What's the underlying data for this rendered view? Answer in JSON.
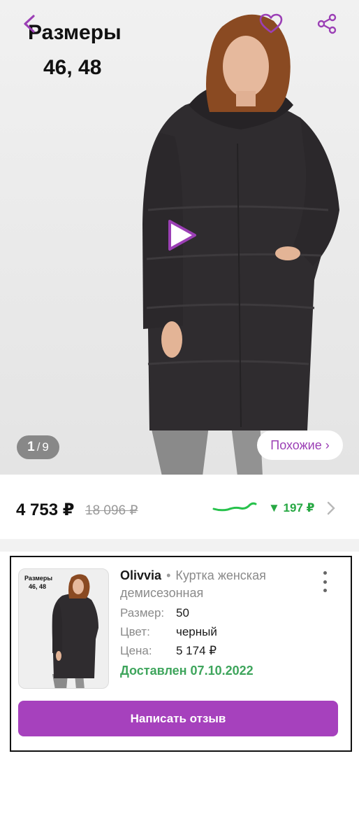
{
  "hero": {
    "overlay_title": "Размеры",
    "overlay_sizes": "46, 48",
    "counter_current": "1",
    "counter_separator": "/",
    "counter_total": "9",
    "similar_label": "Похожие ›"
  },
  "price_row": {
    "price": "4 753 ₽",
    "old_price": "18 096 ₽",
    "delta": "▼ 197 ₽"
  },
  "order": {
    "thumb_title": "Размеры",
    "thumb_sizes": "46, 48",
    "brand": "Olivvia",
    "separator": "•",
    "product_name": "Куртка женская демисезонная",
    "attributes": [
      {
        "key": "Размер:",
        "value": "50"
      },
      {
        "key": "Цвет:",
        "value": "черный"
      },
      {
        "key": "Цена:",
        "value": "5 174 ₽"
      }
    ],
    "delivered": "Доставлен 07.10.2022",
    "review_button": "Написать отзыв"
  },
  "colors": {
    "accent": "#9b3fb5",
    "button": "#a641bd",
    "green": "#3ea55c",
    "price_down": "#27a843"
  },
  "icons": [
    "back-icon",
    "heart-icon",
    "share-icon",
    "play-icon",
    "sparkline-icon",
    "chevron-right-icon",
    "more-vert-icon"
  ]
}
